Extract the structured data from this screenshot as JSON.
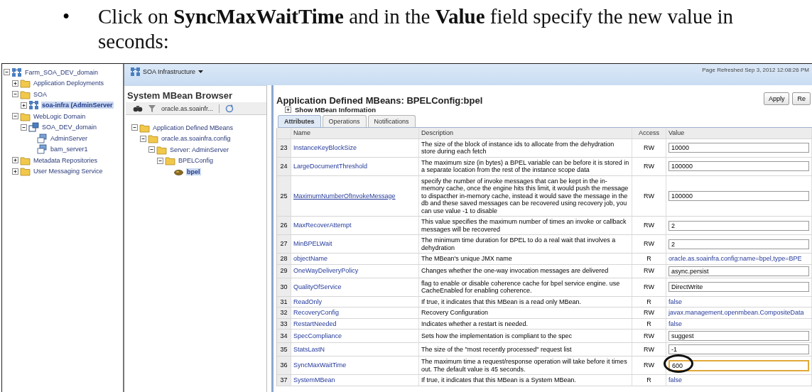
{
  "instruction": {
    "bullet": "•",
    "text": "Click on **SyncMaxWaitTime** and in the **Value** field specify the new value in seconds:"
  },
  "nav": [
    {
      "label": "Farm_SOA_DEV_domain",
      "kind": "farm",
      "expanded": true,
      "selected": false,
      "children": [
        {
          "label": "Application Deployments",
          "kind": "folder",
          "expanded": false,
          "selected": false
        },
        {
          "label": "SOA",
          "kind": "folder",
          "expanded": true,
          "selected": false,
          "children": [
            {
              "label": "soa-infra (AdminServer",
              "kind": "farm",
              "expanded": false,
              "selected": true
            }
          ]
        },
        {
          "label": "WebLogic Domain",
          "kind": "folder",
          "expanded": true,
          "selected": false,
          "children": [
            {
              "label": "SOA_DEV_domain",
              "kind": "domain",
              "expanded": true,
              "selected": false,
              "children": [
                {
                  "label": "AdminServer",
                  "kind": "server",
                  "selected": false
                },
                {
                  "label": "bam_server1",
                  "kind": "server",
                  "selected": false
                }
              ]
            }
          ]
        },
        {
          "label": "Metadata Repositories",
          "kind": "folder",
          "expanded": false,
          "selected": false
        },
        {
          "label": "User Messaging Service",
          "kind": "folder",
          "expanded": false,
          "selected": false
        }
      ]
    }
  ],
  "top_bar": {
    "menu": "SOA Infrastructure",
    "refreshed": "Page Refreshed Sep 3, 2012 12:08:26 PM"
  },
  "browser": {
    "title": "System MBean Browser",
    "filter": "oracle.as.soainfr...",
    "tree": [
      {
        "label": "Application Defined MBeans",
        "kind": "folder",
        "expanded": true,
        "selected": false,
        "children": [
          {
            "label": "oracle.as.soainfra.config",
            "kind": "folder",
            "expanded": true,
            "selected": false,
            "children": [
              {
                "label": "Server: AdminServer",
                "kind": "folder",
                "expanded": true,
                "selected": false,
                "children": [
                  {
                    "label": "BPELConfig",
                    "kind": "folder",
                    "expanded": true,
                    "selected": false,
                    "children": [
                      {
                        "label": "bpel",
                        "kind": "bean",
                        "selected": true
                      }
                    ]
                  }
                ]
              }
            ]
          }
        ]
      }
    ]
  },
  "detail": {
    "title": "Application Defined MBeans: BPELConfig:bpel",
    "buttons": [
      "Apply",
      "Re"
    ],
    "info_toggle": {
      "label": "Show MBean Information",
      "expanded": false
    },
    "tabs": [
      {
        "label": "Attributes",
        "selected": true
      },
      {
        "label": "Operations",
        "selected": false
      },
      {
        "label": "Notifications",
        "selected": false
      }
    ],
    "columns": [
      "Name",
      "Description",
      "Access",
      "Value"
    ],
    "rows": [
      {
        "num": "23",
        "name": "InstanceKeyBlockSize",
        "description": "The size of the block of instance ids to allocate from the dehydration store during each fetch",
        "access": "RW",
        "value": "10000",
        "kind": "field"
      },
      {
        "num": "24",
        "name": "LargeDocumentThreshold",
        "description": "The maximum size (in bytes) a BPEL variable can be before it is stored in a separate location from the rest of the instance scope data",
        "access": "RW",
        "value": "100000",
        "kind": "field"
      },
      {
        "num": "25",
        "name": "MaximumNumberOfInvokeMessage",
        "description": "specify the number of invoke messages that can be kept in the in-memory cache, once the engine hits this limit, it would push the message to dispacther in-memory cache, instead it would save the message in the db and these saved messages can be recovered using recovery job, you can use value -1 to disable",
        "access": "RW",
        "value": "100000",
        "kind": "field",
        "underlined": true
      },
      {
        "num": "26",
        "name": "MaxRecoverAttempt",
        "description": "This value specifies the maximum number of times an invoke or callback messages will be recovered",
        "access": "RW",
        "value": "2",
        "kind": "field"
      },
      {
        "num": "27",
        "name": "MinBPELWait",
        "description": "The minimum time duration for BPEL to do a real wait that involves a dehydration",
        "access": "RW",
        "value": "2",
        "kind": "field"
      },
      {
        "num": "28",
        "name": "objectName",
        "description": "The MBean's unique JMX name",
        "access": "R",
        "value": "oracle.as.soainfra.config:name=bpel,type=BPE",
        "kind": "link"
      },
      {
        "num": "29",
        "name": "OneWayDeliveryPolicy",
        "description": "Changes whether the one-way invocation messages are delivered",
        "access": "RW",
        "value": "async.persist",
        "kind": "field"
      },
      {
        "num": "30",
        "name": "QualityOfService",
        "description": "flag to enable or disable coherence cache for bpel service engine. use CacheEnabled for enabling coherence.",
        "access": "RW",
        "value": "DirectWrite",
        "kind": "field"
      },
      {
        "num": "31",
        "name": "ReadOnly",
        "description": "If true, it indicates that this MBean is a read only MBean.",
        "access": "R",
        "value": "false",
        "kind": "link"
      },
      {
        "num": "32",
        "name": "RecoveryConfig",
        "description": "Recovery Configuration",
        "access": "RW",
        "value": "javax.management.openmbean.CompositeData",
        "kind": "link"
      },
      {
        "num": "33",
        "name": "RestartNeeded",
        "description": "Indicates whether a restart is needed.",
        "access": "R",
        "value": "false",
        "kind": "link"
      },
      {
        "num": "34",
        "name": "SpecCompliance",
        "description": "Sets how the implementation is compliant to the spec",
        "access": "RW",
        "value": "suggest",
        "kind": "field"
      },
      {
        "num": "35",
        "name": "StatsLastN",
        "description": "The size of the \"most recently processed\" request list",
        "access": "RW",
        "value": "-1",
        "kind": "field"
      },
      {
        "num": "36",
        "name": "SyncMaxWaitTime",
        "description": "The maximum time a request/response operation will take before it times out. The default value is 45 seconds.",
        "access": "RW",
        "value": "600",
        "kind": "field",
        "focused": true,
        "circled": true
      },
      {
        "num": "37",
        "name": "SystemMBean",
        "description": "If true, it indicates that this MBean is a System MBean.",
        "access": "R",
        "value": "false",
        "kind": "link"
      }
    ]
  }
}
